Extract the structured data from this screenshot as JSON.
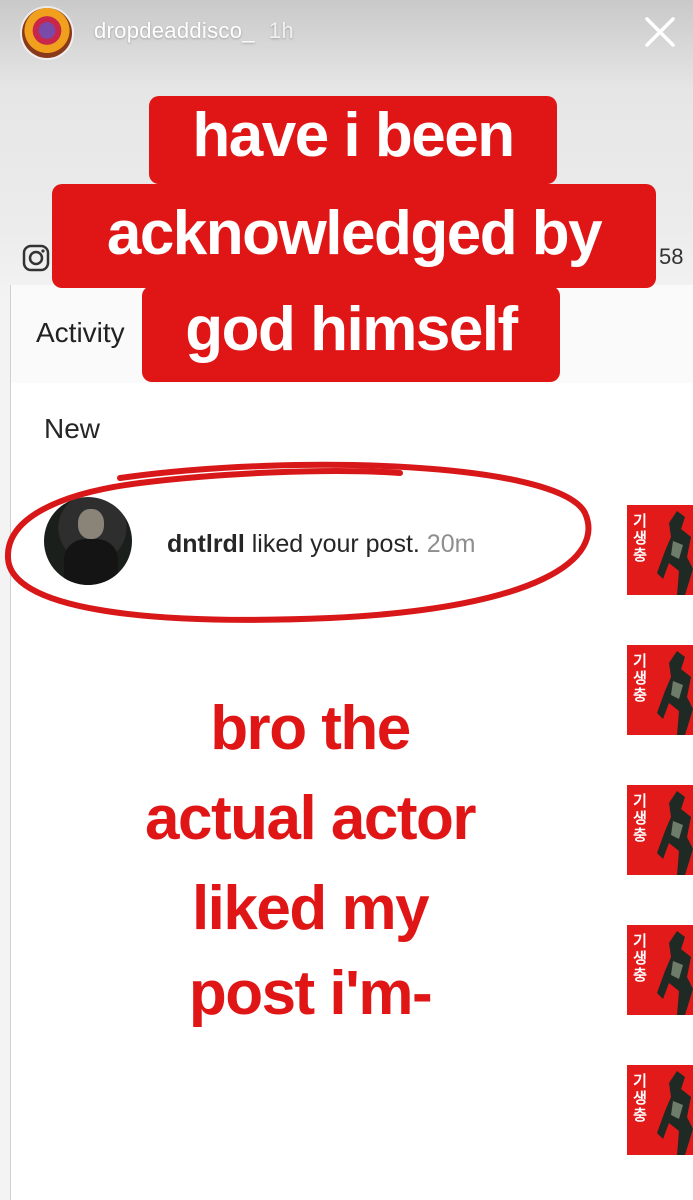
{
  "story": {
    "username": "dropdeaddisco_",
    "time": "1h",
    "close_icon": "close-icon",
    "avatar_icon": "profile-avatar"
  },
  "screenshot": {
    "instagram_icon": "instagram-icon",
    "count": "58",
    "activity_title": "Activity",
    "section_label": "New",
    "notification": {
      "username": "dntlrdl",
      "message": " liked your post. ",
      "time": "20m"
    },
    "thumbnail_text": "기생충",
    "thumbnail_count": 5
  },
  "stickers": {
    "line1": "have i been",
    "line2": "acknowledged by",
    "line3": "god himself"
  },
  "caption": {
    "line1": "bro the",
    "line2": "actual actor",
    "line3": "liked my",
    "line4": "post i'm-"
  },
  "colors": {
    "sticker_red": "#e01616",
    "oval_red": "#d81818"
  }
}
